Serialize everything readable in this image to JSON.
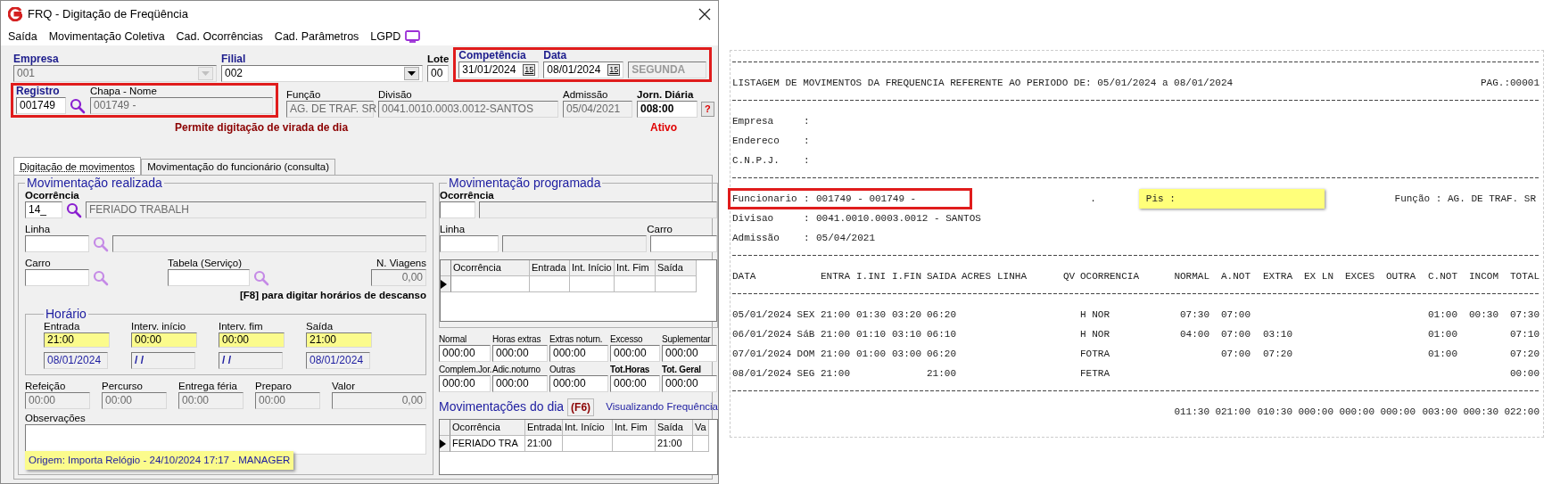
{
  "window": {
    "title": "FRQ - Digitação de Freqüência"
  },
  "menu": [
    {
      "label": "Saída"
    },
    {
      "label": "Movimentação Coletiva"
    },
    {
      "label": "Cad. Ocorrências"
    },
    {
      "label": "Cad. Parâmetros"
    },
    {
      "label": "LGPD",
      "kind": "monitor"
    }
  ],
  "header": {
    "empresa": {
      "label": "Empresa",
      "value": "001",
      "disabled": true
    },
    "filial": {
      "label": "Filial",
      "value": "002",
      "disabled": false
    },
    "lote": {
      "label": "Lote",
      "value": "00"
    },
    "periodo": {
      "framed": true,
      "fields": [
        {
          "label": "Competência",
          "value": "31/01/2024",
          "button": "15"
        },
        {
          "label": "Data",
          "value": "08/01/2024",
          "button": "15"
        }
      ],
      "weekday": "SEGUNDA"
    },
    "funcionario": {
      "framed": true,
      "registro": {
        "label": "Registro",
        "value": "001749",
        "lookup_disabled": false
      },
      "nome": {
        "label": "Chapa  -  Nome",
        "value": "001749 -"
      }
    },
    "info": [
      {
        "label": "Função",
        "value": "AG. DE TRAF. SR"
      },
      {
        "label": "Divisão",
        "value": "0041.0010.0003.0012-SANTOS"
      },
      {
        "label": "Admissão",
        "value": "05/04/2021"
      }
    ],
    "jornada": {
      "label": "Jorn. Diária",
      "value": "008:00",
      "help": "?"
    },
    "notice": "Permite digitação de virada de dia",
    "status": "Ativo"
  },
  "tabs": [
    {
      "label": "Digitação de movimentos",
      "selected": true
    },
    {
      "label": "Movimentação do funcionário (consulta)",
      "selected": false
    }
  ],
  "realizada": {
    "title": "Movimentação realizada",
    "ocorrencia": {
      "label": "Ocorrência",
      "code": "14_",
      "description": "FERIADO TRABALH",
      "lookup_disabled": false
    },
    "linha": {
      "label": "Linha",
      "lookup_disabled": true
    },
    "carro": {
      "label": "Carro",
      "lookup_disabled": true
    },
    "tabela": {
      "label": "Tabela (Serviço)",
      "lookup_disabled": true
    },
    "viagens": {
      "label": "N. Viagens",
      "value": "0,00"
    },
    "hint": "[F8] para digitar horários de descanso",
    "horario": {
      "title": "Horário",
      "columns": [
        {
          "label": "Entrada",
          "time": "21:00",
          "date": "08/01/2024"
        },
        {
          "label": "Interv. início",
          "time": "00:00",
          "date": "/ /"
        },
        {
          "label": "Interv. fim",
          "time": "00:00",
          "date": "/ /"
        },
        {
          "label": "Saída",
          "time": "21:00",
          "date": "08/01/2024"
        }
      ]
    },
    "extras": [
      {
        "label": "Refeição",
        "value": "00:00",
        "kind": "time"
      },
      {
        "label": "Percurso",
        "value": "00:00",
        "kind": "time"
      },
      {
        "label": "Entrega féria",
        "value": "00:00",
        "kind": "time"
      },
      {
        "label": "Preparo",
        "value": "00:00",
        "kind": "time"
      },
      {
        "label": "Valor",
        "value": "0,00",
        "kind": "number"
      }
    ],
    "observacoes": {
      "label": "Observações",
      "origin": "Origem: Importa Relógio - 24/10/2024 17:17 - MANAGER"
    }
  },
  "programada": {
    "title": "Movimentação programada",
    "ocorrencia": {
      "label": "Ocorrência"
    },
    "linha": {
      "label": "Linha"
    },
    "carro": {
      "label": "Carro"
    },
    "columns": [
      "Ocorrência",
      "Entrada",
      "Int. Início",
      "Int. Fim",
      "Saída"
    ],
    "rows": [
      {
        "selected": true,
        "cells": [
          null,
          null,
          null,
          null,
          null
        ]
      }
    ]
  },
  "totais": [
    {
      "label": "Normal",
      "value": "000:00",
      "bold": false
    },
    {
      "label": "Horas extras",
      "value": "000:00",
      "bold": false
    },
    {
      "label": "Extras noturn.",
      "value": "000:00",
      "bold": false
    },
    {
      "label": "Excesso",
      "value": "000:00",
      "bold": false
    },
    {
      "label": "Suplementar",
      "value": "000:00",
      "bold": false
    },
    {
      "label": "Complem.Jor.",
      "value": "000:00",
      "bold": false
    },
    {
      "label": "Adic.noturno",
      "value": "000:00",
      "bold": false
    },
    {
      "label": "Outras",
      "value": "000:00",
      "bold": false
    },
    {
      "label": "Tot.Horas",
      "value": "000:00",
      "bold": true
    },
    {
      "label": "Tot. Geral",
      "value": "000:00",
      "bold": true
    }
  ],
  "dia": {
    "title": "Movimentações do dia",
    "key": "(F6)",
    "status": "Visualizando Frequência",
    "columns": [
      "Ocorrência",
      "Entrada",
      "Int. Início",
      "Int. Fim",
      "Saída",
      "Va"
    ],
    "rows": [
      {
        "selected": true,
        "cells": [
          "FERIADO TRA",
          "21:00",
          null,
          null,
          "21:00",
          null
        ]
      }
    ]
  },
  "report": {
    "title": "LISTAGEM DE MOVIMENTOS DA FREQUENCIA REFERENTE AO PERIODO DE: 05/01/2024 a 08/01/2024",
    "page": "PAG.:00001",
    "company": [
      {
        "label": "Empresa",
        "separator": ":"
      },
      {
        "label": "Endereco",
        "separator": ":"
      },
      {
        "label": "C.N.P.J.",
        "separator": ":"
      }
    ],
    "employee": {
      "framed": true,
      "label": "Funcionario",
      "separator": ":",
      "value": "001749 - 001749 -"
    },
    "dot": ".",
    "pis": {
      "label": "Pis :",
      "highlighted": true
    },
    "funcao": "Função : AG. DE TRAF. SR",
    "details": [
      {
        "label": "Divisao",
        "separator": ":",
        "value": "0041.0010.0003.0012 - SANTOS"
      },
      {
        "label": "Admissão",
        "separator": ":",
        "value": "05/04/2021"
      }
    ],
    "columns": [
      "DATA",
      "ENTRA",
      "I.INI",
      "I.FIN",
      "SAIDA",
      "ACRES",
      "LINHA",
      "QV",
      "OCORRENCIA",
      "NORMAL",
      "A.NOT",
      "EXTRA",
      "EX LN",
      "EXCES",
      "OUTRA",
      "C.NOT",
      "INCOM",
      "TOTAL"
    ],
    "rows": [
      {
        "cells": [
          "05/01/2024 SEX",
          "21:00",
          "01:30",
          "03:20",
          "06:20",
          null,
          null,
          null,
          "H NOR",
          "07:30",
          "07:00",
          null,
          null,
          null,
          null,
          "01:00",
          "00:30",
          "07:30"
        ]
      },
      {
        "cells": [
          "06/01/2024 SáB",
          "21:00",
          "01:10",
          "03:10",
          "06:10",
          null,
          null,
          null,
          "H NOR",
          "04:00",
          "07:00",
          "03:10",
          null,
          null,
          null,
          "01:00",
          null,
          "07:10"
        ]
      },
      {
        "cells": [
          "07/01/2024 DOM",
          "21:00",
          "01:00",
          "03:00",
          "06:20",
          null,
          null,
          null,
          "FOTRA",
          null,
          "07:00",
          "07:20",
          null,
          null,
          null,
          "01:00",
          null,
          "07:20"
        ]
      },
      {
        "cells": [
          "08/01/2024 SEG",
          "21:00",
          null,
          null,
          "21:00",
          null,
          null,
          null,
          "FETRA",
          null,
          null,
          null,
          null,
          null,
          null,
          null,
          null,
          "00:00"
        ]
      }
    ],
    "totals": [
      "011:30",
      "021:00",
      "010:30",
      "000:00",
      "000:00",
      "000:00",
      "003:00",
      "000:30",
      "022:00"
    ]
  }
}
